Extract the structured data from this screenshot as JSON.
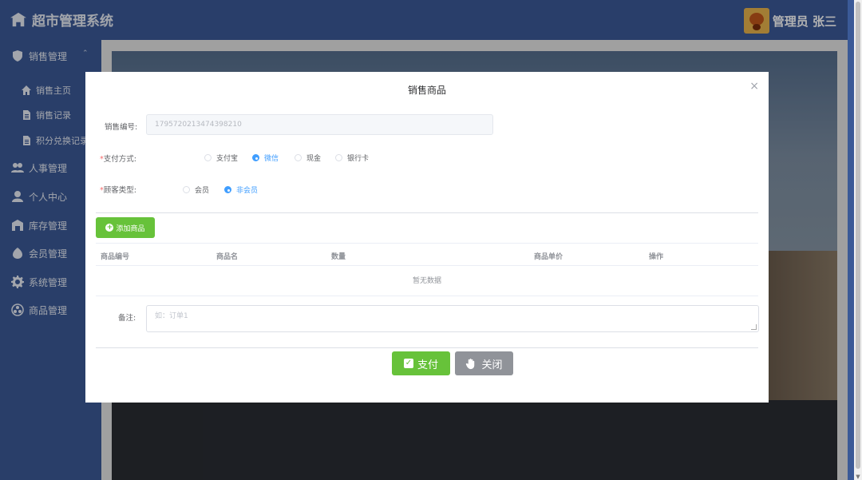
{
  "app": {
    "title": "超市管理系统"
  },
  "user": {
    "role_name": "管理员 张三"
  },
  "sidebar": {
    "items": [
      {
        "label": "销售管理",
        "icon": "shield-icon"
      },
      {
        "label": "人事管理",
        "icon": "users-icon"
      },
      {
        "label": "个人中心",
        "icon": "person-icon"
      },
      {
        "label": "库存管理",
        "icon": "warehouse-icon"
      },
      {
        "label": "会员管理",
        "icon": "member-icon"
      },
      {
        "label": "系统管理",
        "icon": "gear-icon"
      },
      {
        "label": "商品管理",
        "icon": "goods-icon"
      }
    ],
    "sub_items": [
      {
        "label": "销售主页",
        "icon": "home-icon"
      },
      {
        "label": "销售记录",
        "icon": "document-icon"
      },
      {
        "label": "积分兑换记录",
        "icon": "document-icon"
      }
    ]
  },
  "modal": {
    "title": "销售商品",
    "close": "×",
    "sale_no_label": "销售编号:",
    "sale_no_value": "1795720213474398210",
    "payment_label": "支付方式:",
    "payment_options": [
      "支付宝",
      "微信",
      "现金",
      "银行卡"
    ],
    "payment_selected": "微信",
    "customer_label": "顾客类型:",
    "customer_options": [
      "会员",
      "非会员"
    ],
    "customer_selected": "非会员",
    "add_button": "添加商品",
    "table": {
      "columns": [
        "商品编号",
        "商品名",
        "数量",
        "商品单价",
        "操作"
      ],
      "empty_text": "暂无数据"
    },
    "remark_label": "备注:",
    "remark_placeholder": "如：订单1",
    "pay_button": "支付",
    "close_button": "关闭"
  },
  "colors": {
    "primary_nav": "#3c5a99",
    "success": "#67c23a",
    "info": "#909399",
    "accent": "#409eff"
  }
}
